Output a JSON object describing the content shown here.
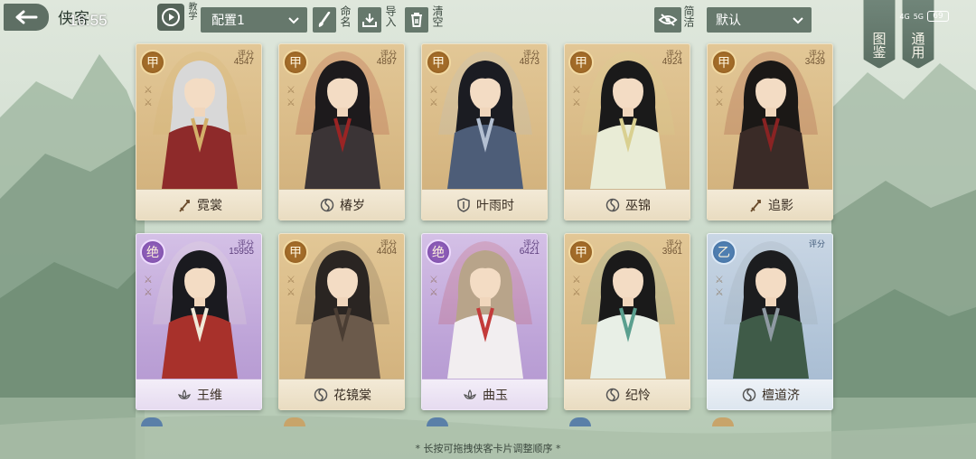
{
  "topbar": {
    "title": "侠客",
    "clock": "16:55",
    "teach_label": "教学",
    "preset": "配置1",
    "rename_label": "命名",
    "import_label": "导入",
    "clear_label": "清空",
    "simple_label": "简洁",
    "sort": "默认",
    "codex_label": "图鉴",
    "general_label": "通用",
    "battery": "69",
    "network_a": "4G",
    "network_b": "5G"
  },
  "cards": [
    {
      "name": "霓裳",
      "grade": "甲",
      "score_label": "评分",
      "score": "4547",
      "tier": "gold",
      "class_icon": "sword-icon",
      "colors": {
        "robe": "#8e2a2a",
        "hair": "#d8d8d8",
        "accent": "#d3b06a"
      }
    },
    {
      "name": "椿岁",
      "grade": "甲",
      "score_label": "评分",
      "score": "4897",
      "tier": "gold",
      "class_icon": "swirl-icon",
      "colors": {
        "robe": "#3b3436",
        "hair": "#1d1a1c",
        "accent": "#9a2424"
      }
    },
    {
      "name": "叶雨时",
      "grade": "甲",
      "score_label": "评分",
      "score": "4873",
      "tier": "gold",
      "class_icon": "shield-icon",
      "colors": {
        "robe": "#4d5d78",
        "hair": "#1b1c22",
        "accent": "#b4c0d2"
      }
    },
    {
      "name": "巫锦",
      "grade": "甲",
      "score_label": "评分",
      "score": "4924",
      "tier": "gold",
      "class_icon": "swirl-icon",
      "colors": {
        "robe": "#e9ecd6",
        "hair": "#1a1a1a",
        "accent": "#d9d090"
      }
    },
    {
      "name": "追影",
      "grade": "甲",
      "score_label": "评分",
      "score": "3439",
      "tier": "gold",
      "class_icon": "sword-icon",
      "colors": {
        "robe": "#3a2b27",
        "hair": "#1b1816",
        "accent": "#8a2323"
      }
    },
    {
      "name": "王维",
      "grade": "绝",
      "score_label": "评分",
      "score": "15955",
      "tier": "purple",
      "class_icon": "lotus-icon",
      "colors": {
        "robe": "#a8312b",
        "hair": "#1a1a1f",
        "accent": "#f1ead9"
      }
    },
    {
      "name": "花镜棠",
      "grade": "甲",
      "score_label": "评分",
      "score": "4404",
      "tier": "gold",
      "class_icon": "swirl-icon",
      "colors": {
        "robe": "#6b5a4b",
        "hair": "#2a2522",
        "accent": "#4a3d33"
      }
    },
    {
      "name": "曲玉",
      "grade": "绝",
      "score_label": "评分",
      "score": "6421",
      "tier": "purple",
      "class_icon": "lotus-icon",
      "colors": {
        "robe": "#f2eef0",
        "hair": "#b8a48a",
        "accent": "#c33a3a"
      }
    },
    {
      "name": "纪怜",
      "grade": "甲",
      "score_label": "评分",
      "score": "3961",
      "tier": "gold",
      "class_icon": "swirl-icon",
      "colors": {
        "robe": "#e8efe6",
        "hair": "#1a1a1a",
        "accent": "#5a9f8e"
      }
    },
    {
      "name": "檀道济",
      "grade": "乙",
      "score_label": "评分",
      "score": "",
      "tier": "blue",
      "class_icon": "swirl-icon",
      "colors": {
        "robe": "#3f5b48",
        "hair": "#1c1d1f",
        "accent": "#8f9aa3"
      }
    }
  ],
  "hint": "* 长按可拖拽侠客卡片调整顺序 *"
}
